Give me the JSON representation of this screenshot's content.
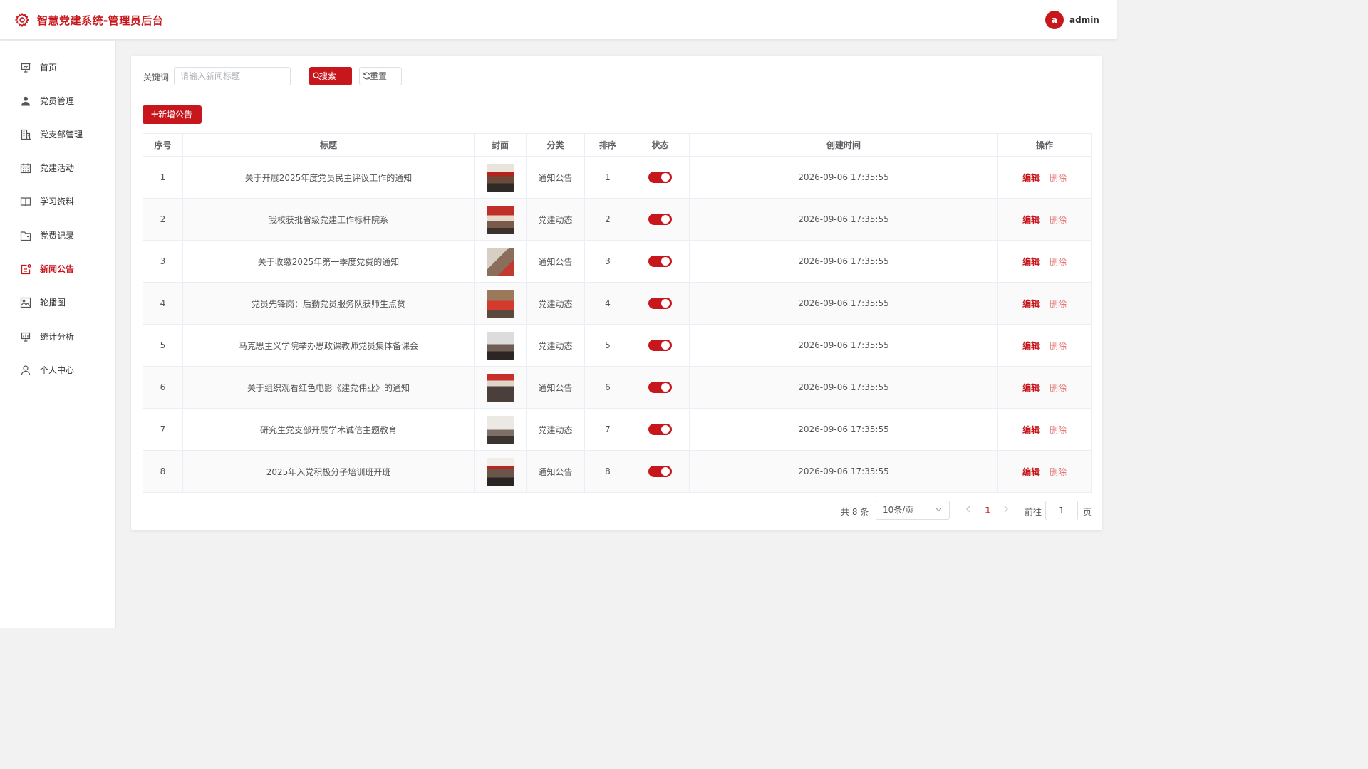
{
  "header": {
    "title": "智慧党建系统-管理员后台",
    "avatar_letter": "a",
    "username": "admin",
    "accent_color": "#c8161d"
  },
  "sidebar": {
    "items": [
      {
        "label": "首页",
        "icon": "presentation-icon"
      },
      {
        "label": "党员管理",
        "icon": "user-icon"
      },
      {
        "label": "党支部管理",
        "icon": "building-icon"
      },
      {
        "label": "党建活动",
        "icon": "calendar-icon"
      },
      {
        "label": "学习资料",
        "icon": "book-icon"
      },
      {
        "label": "党费记录",
        "icon": "folder-icon"
      },
      {
        "label": "新闻公告",
        "icon": "news-icon",
        "active": true
      },
      {
        "label": "轮播图",
        "icon": "image-icon"
      },
      {
        "label": "统计分析",
        "icon": "chart-icon"
      },
      {
        "label": "个人中心",
        "icon": "person-icon"
      }
    ]
  },
  "search": {
    "label": "关键词",
    "placeholder": "请输入新闻标题",
    "value": "",
    "search_label": "搜索",
    "reset_label": "重置"
  },
  "toolbar": {
    "add_label": "新增公告"
  },
  "table": {
    "columns": [
      "序号",
      "标题",
      "封面",
      "分类",
      "排序",
      "状态",
      "创建时间",
      "操作"
    ],
    "edit_label": "编辑",
    "delete_label": "删除",
    "rows": [
      {
        "no": "1",
        "title": "关于开展2025年度党员民主评议工作的通知",
        "category": "通知公告",
        "sort": "1",
        "status": true,
        "created": "2026-09-06 17:35:55"
      },
      {
        "no": "2",
        "title": "我校获批省级党建工作标杆院系",
        "category": "党建动态",
        "sort": "2",
        "status": true,
        "created": "2026-09-06 17:35:55"
      },
      {
        "no": "3",
        "title": "关于收缴2025年第一季度党费的通知",
        "category": "通知公告",
        "sort": "3",
        "status": true,
        "created": "2026-09-06 17:35:55"
      },
      {
        "no": "4",
        "title": "党员先锋岗：后勤党员服务队获师生点赞",
        "category": "党建动态",
        "sort": "4",
        "status": true,
        "created": "2026-09-06 17:35:55"
      },
      {
        "no": "5",
        "title": "马克思主义学院举办思政课教师党员集体备课会",
        "category": "党建动态",
        "sort": "5",
        "status": true,
        "created": "2026-09-06 17:35:55"
      },
      {
        "no": "6",
        "title": "关于组织观看红色电影《建党伟业》的通知",
        "category": "通知公告",
        "sort": "6",
        "status": true,
        "created": "2026-09-06 17:35:55"
      },
      {
        "no": "7",
        "title": "研究生党支部开展学术诚信主题教育",
        "category": "党建动态",
        "sort": "7",
        "status": true,
        "created": "2026-09-06 17:35:55"
      },
      {
        "no": "8",
        "title": "2025年入党积极分子培训班开班",
        "category": "通知公告",
        "sort": "8",
        "status": true,
        "created": "2026-09-06 17:35:55"
      }
    ]
  },
  "pagination": {
    "total_text": "共 8 条",
    "page_size": "10条/页",
    "current_page": "1",
    "goto_label": "前往",
    "goto_value": "1",
    "page_suffix": "页"
  }
}
